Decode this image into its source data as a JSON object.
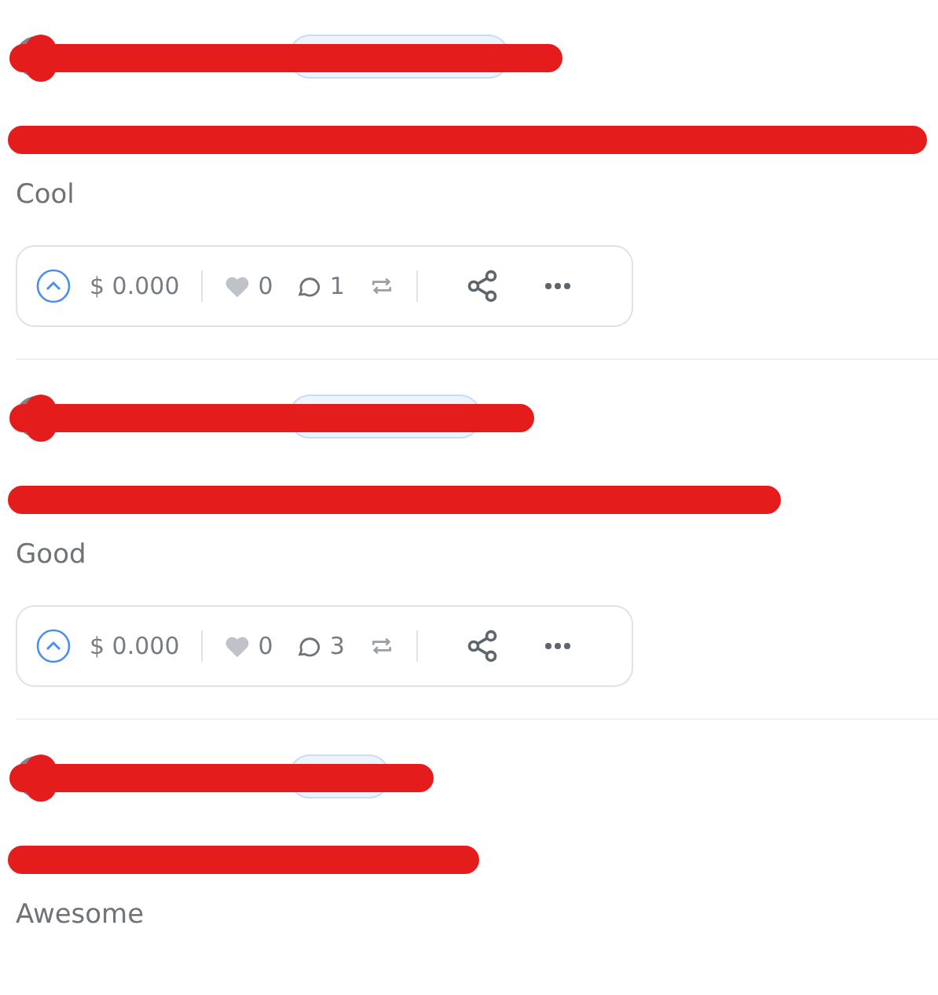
{
  "posts": [
    {
      "body": "Cool",
      "actions": {
        "tip": "$ 0.000",
        "likes": "0",
        "comments": "1"
      }
    },
    {
      "body": "Good",
      "actions": {
        "tip": "$ 0.000",
        "likes": "0",
        "comments": "3"
      }
    },
    {
      "body": "Awesome"
    }
  ]
}
